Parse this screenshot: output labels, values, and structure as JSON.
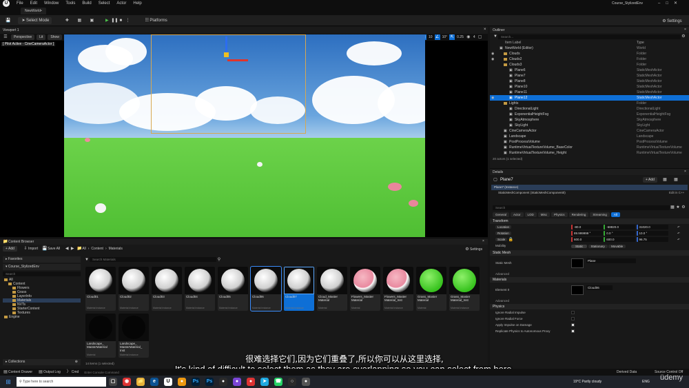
{
  "menu": {
    "items": [
      "File",
      "Edit",
      "Window",
      "Tools",
      "Build",
      "Select",
      "Actor",
      "Help"
    ],
    "project": "Course_StylizedEnv"
  },
  "level_tab": "NewWorld•",
  "toolbar": {
    "select_mode": "Select Mode",
    "platforms": "Platforms",
    "settings": "Settings"
  },
  "viewport": {
    "tab": "Viewport 1",
    "perspective": "Perspective",
    "lit": "Lit",
    "show": "Show",
    "pilot": "[ Pilot Active - CineCameraActor ]",
    "grid": "10",
    "angle": "10°",
    "scale": "0.25",
    "cams": "4"
  },
  "outliner": {
    "title": "Outliner",
    "search_placeholder": "Search...",
    "col_label": "Item Label",
    "col_type": "Type",
    "rows": [
      {
        "label": "NewWorld (Editor)",
        "type": "World"
      },
      {
        "label": "Clouds",
        "type": "Folder"
      },
      {
        "label": "Clouds2",
        "type": "Folder"
      },
      {
        "label": "Clouds3",
        "type": "Folder"
      },
      {
        "label": "Plane6",
        "type": "StaticMeshActor"
      },
      {
        "label": "Plane7",
        "type": "StaticMeshActor"
      },
      {
        "label": "Plane8",
        "type": "StaticMeshActor"
      },
      {
        "label": "Plane10",
        "type": "StaticMeshActor"
      },
      {
        "label": "Plane11",
        "type": "StaticMeshActor"
      },
      {
        "label": "Plane12",
        "type": "StaticMeshActor"
      },
      {
        "label": "Lights",
        "type": "Folder"
      },
      {
        "label": "DirectionalLight",
        "type": "DirectionalLight"
      },
      {
        "label": "ExponentialHeightFog",
        "type": "ExponentialHeightFog"
      },
      {
        "label": "SkyAtmosphere",
        "type": "SkyAtmosphere"
      },
      {
        "label": "SkyLight",
        "type": "SkyLight"
      },
      {
        "label": "CineCameraActor",
        "type": "CineCameraActor"
      },
      {
        "label": "Landscape",
        "type": "Landscape"
      },
      {
        "label": "PostProcessVolume",
        "type": "PostProcessVolume"
      },
      {
        "label": "RuntimeVirtualTextureVolume_BaseColor",
        "type": "RuntimeVirtualTextureVolume"
      },
      {
        "label": "RuntimeVirtualTextureVolume_Height",
        "type": "RuntimeVirtualTextureVolume"
      }
    ],
    "footer": "20 actors (1 selected)"
  },
  "details": {
    "title": "Details",
    "actor_name": "Plane7",
    "add_label": "+ Add",
    "instance": "Plane7 (Instance)",
    "component": "StaticMeshComponent (StaticMeshComponent0)",
    "edit_cpp": "Edit in C++",
    "search_placeholder": "Search",
    "tabs": [
      "General",
      "Actor",
      "LOD",
      "Misc",
      "Physics",
      "Rendering",
      "Streaming",
      "All"
    ],
    "transform_label": "Transform",
    "location": {
      "label": "Location",
      "x": "-80.0",
      "y": "-68820.0",
      "z": "31020.0"
    },
    "rotation": {
      "label": "Rotation",
      "x": "89.999999 °",
      "y": "0.0 °",
      "z": "10.0 °"
    },
    "scale": {
      "label": "Scale",
      "x": "600.0",
      "y": "600.0",
      "z": "96.75"
    },
    "mobility": {
      "label": "Mobility",
      "options": [
        "Static",
        "Stationary",
        "Movable"
      ]
    },
    "static_mesh_section": "Static Mesh",
    "static_mesh_label": "Static Mesh",
    "static_mesh_value": "Plane",
    "advanced": "Advanced",
    "materials_section": "Materials",
    "element0": "Element 0",
    "material_value": "Cloud06",
    "advanced2": "Advanced",
    "physics_section": "Physics",
    "physics_rows": [
      "Ignore Radial Impulse",
      "Ignore Radial Force",
      "Apply Impulse on Damage",
      "Replicate Physics to Autonomous Proxy"
    ]
  },
  "content_browser": {
    "tab": "Content Browser",
    "add": "+ Add",
    "import": "Import",
    "save_all": "Save All",
    "path": [
      "All",
      "Content",
      "Materials"
    ],
    "settings": "Settings",
    "favorites": "Favorites",
    "project": "Course_StylizedEnv",
    "search_placeholder": "Search Materials",
    "search_tree_placeholder": "Search",
    "tree": [
      "All",
      "Content",
      "Flowers",
      "Grass",
      "LayerInfo",
      "Materials",
      "NVTs",
      "StarterContent",
      "Textures",
      "Engine"
    ],
    "assets": [
      {
        "name": "Cloud01",
        "sub": "Material Instance"
      },
      {
        "name": "Cloud02",
        "sub": "Material Instance"
      },
      {
        "name": "Cloud03",
        "sub": "Material Instance"
      },
      {
        "name": "Cloud04",
        "sub": "Material Instance"
      },
      {
        "name": "Cloud05",
        "sub": "Material Instance"
      },
      {
        "name": "Cloud06",
        "sub": "Material Instance"
      },
      {
        "name": "Cloud07",
        "sub": "Material Instance"
      },
      {
        "name": "Cloud_Master Material",
        "sub": "Material"
      },
      {
        "name": "Flowers_Master Material",
        "sub": "Material"
      },
      {
        "name": "Flowers_Master Material_Inst",
        "sub": "Material Instance"
      },
      {
        "name": "Grass_Master Material",
        "sub": "Material"
      },
      {
        "name": "Grass_Master Material_Inst",
        "sub": "Material Instance"
      },
      {
        "name": "Landscape_ MasterMaterial",
        "sub": "Material"
      },
      {
        "name": "Landscape_ MasterMaterial_ Inst",
        "sub": "Material Instance"
      }
    ],
    "footer": "14 items (1 selected)",
    "collections": "Collections"
  },
  "status": {
    "content_drawer": "Content Drawer",
    "output_log": "Output Log",
    "cmd": "Cmd",
    "console_placeholder": "Enter Console Command",
    "derived": "Derived Data",
    "source": "Source Control Off"
  },
  "subtitles": {
    "zh": "很难选择它们,因为它们重叠了,所以你可以从这里选择,",
    "en": "It's kind of difficult to select them as they are overlapping so you can select from here,"
  },
  "taskbar": {
    "search_placeholder": "Type here to search",
    "weather": "19°C  Partly cloudy",
    "lang": "ENG",
    "watermark": "üdemy"
  },
  "colors": {
    "accent": "#0e6fd6",
    "folder": "#c49a42",
    "bg": "#151515"
  }
}
